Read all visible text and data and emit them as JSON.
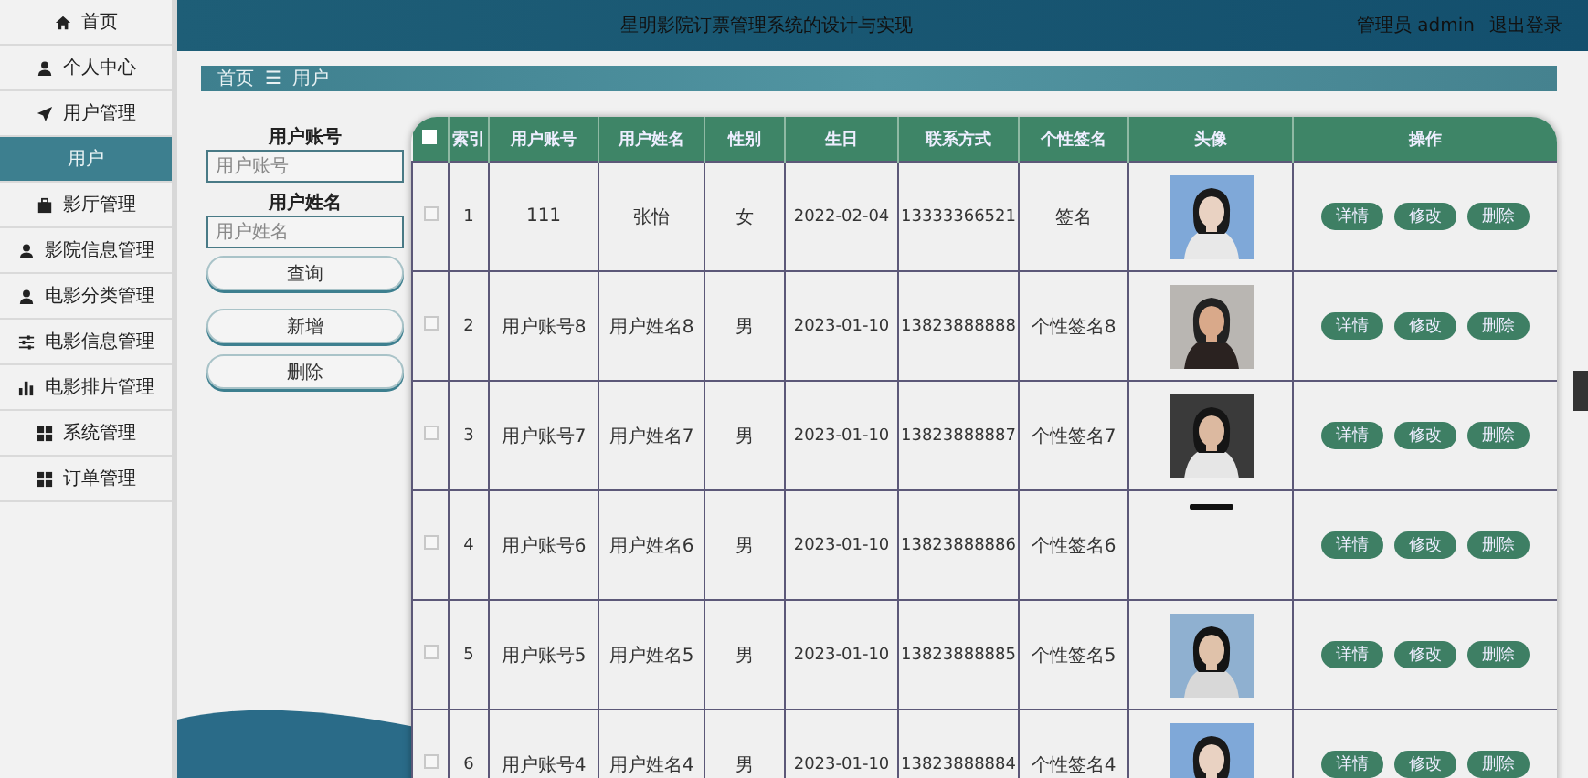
{
  "sidebar": {
    "items": [
      {
        "label": "首页",
        "kind": "menu",
        "selected": false
      },
      {
        "label": "个人中心",
        "kind": "menu",
        "selected": false
      },
      {
        "label": "用户管理",
        "kind": "menu",
        "selected": false
      },
      {
        "label": "用户",
        "kind": "submenu",
        "selected": true
      },
      {
        "label": "影厅管理",
        "kind": "menu",
        "selected": false
      },
      {
        "label": "影院信息管理",
        "kind": "menu",
        "selected": false
      },
      {
        "label": "电影分类管理",
        "kind": "menu",
        "selected": false
      },
      {
        "label": "电影信息管理",
        "kind": "menu",
        "selected": false
      },
      {
        "label": "电影排片管理",
        "kind": "menu",
        "selected": false
      },
      {
        "label": "系统管理",
        "kind": "menu",
        "selected": false
      },
      {
        "label": "订单管理",
        "kind": "menu",
        "selected": false
      }
    ]
  },
  "header": {
    "title": "星明影院订票管理系统的设计与实现",
    "role": "管理员 admin",
    "logout": "退出登录"
  },
  "breadcrumb": {
    "home": "首页",
    "separator": "☰",
    "current": "用户"
  },
  "search": {
    "fields": [
      {
        "label": "用户账号",
        "placeholder": "用户账号"
      },
      {
        "label": "用户姓名",
        "placeholder": "用户姓名"
      }
    ],
    "buttons": [
      "查询",
      "新增",
      "删除"
    ]
  },
  "table": {
    "all_checked": false,
    "columns": [
      "索引",
      "用户账号",
      "用户姓名",
      "性别",
      "生日",
      "联系方式",
      "个性签名",
      "头像",
      "操作"
    ],
    "rows": [
      {
        "checked": false,
        "cells": [
          "1",
          "111",
          "张怡",
          "女",
          "2022-02-04",
          "13333366521",
          "签名"
        ],
        "actions": [
          "详情",
          "修改",
          "删除"
        ]
      },
      {
        "checked": false,
        "cells": [
          "2",
          "用户账号8",
          "用户姓名8",
          "男",
          "2023-01-10",
          "13823888888",
          "个性签名8"
        ],
        "actions": [
          "详情",
          "修改",
          "删除"
        ]
      },
      {
        "checked": false,
        "cells": [
          "3",
          "用户账号7",
          "用户姓名7",
          "男",
          "2023-01-10",
          "13823888887",
          "个性签名7"
        ],
        "actions": [
          "详情",
          "修改",
          "删除"
        ]
      },
      {
        "checked": false,
        "cells": [
          "4",
          "用户账号6",
          "用户姓名6",
          "男",
          "2023-01-10",
          "13823888886",
          "个性签名6"
        ],
        "avatar": {
          "kind": "cropped"
        },
        "actions": [
          "详情",
          "修改",
          "删除"
        ]
      },
      {
        "checked": false,
        "cells": [
          "5",
          "用户账号5",
          "用户姓名5",
          "男",
          "2023-01-10",
          "13823888885",
          "个性签名5"
        ],
        "actions": [
          "详情",
          "修改",
          "删除"
        ]
      },
      {
        "checked": false,
        "cells": [
          "6",
          "用户账号4",
          "用户姓名4",
          "男",
          "2023-01-10",
          "13823888884",
          "个性签名4"
        ],
        "actions": [
          "详情",
          "修改",
          "删除"
        ]
      }
    ]
  }
}
